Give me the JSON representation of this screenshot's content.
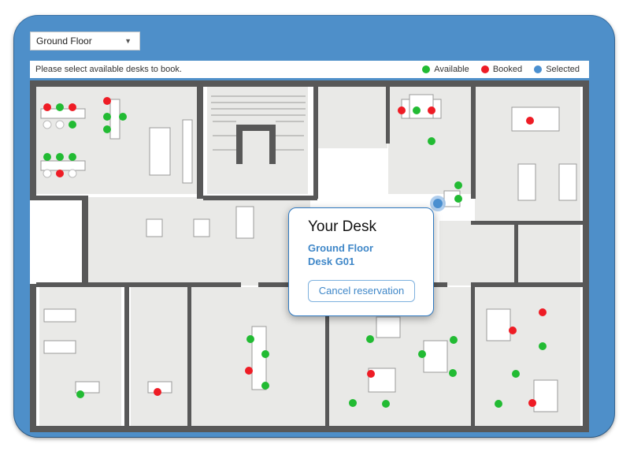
{
  "floor_selector": {
    "value": "Ground Floor",
    "caret": "▼"
  },
  "info_bar": {
    "instructions": "Please select available desks to book."
  },
  "legend": [
    {
      "label": "Available",
      "color": "#22bb33"
    },
    {
      "label": "Booked",
      "color": "#ee1c25"
    },
    {
      "label": "Selected",
      "color": "#4a8fd0"
    }
  ],
  "colors": {
    "frame": "#4e8fc9",
    "available": "#22bb33",
    "booked": "#ee1c25",
    "selected": "#4a8fd0",
    "link": "#3f87c8",
    "room_fill": "#e9e9e7",
    "wall": "#585858"
  },
  "popup": {
    "title": "Your Desk",
    "floor": "Ground Floor",
    "desk": "Desk G01",
    "cancel_label": "Cancel reservation"
  }
}
